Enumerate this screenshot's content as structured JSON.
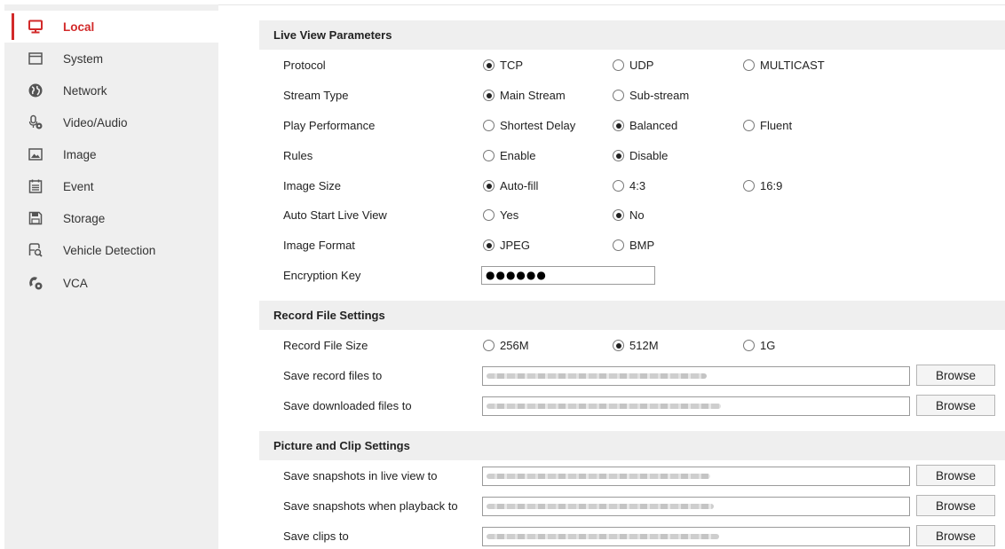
{
  "sidebar": {
    "items": [
      {
        "label": "Local",
        "icon": "monitor-icon",
        "active": true
      },
      {
        "label": "System",
        "icon": "window-icon"
      },
      {
        "label": "Network",
        "icon": "globe-icon"
      },
      {
        "label": "Video/Audio",
        "icon": "microphone-gear-icon"
      },
      {
        "label": "Image",
        "icon": "image-icon"
      },
      {
        "label": "Event",
        "icon": "calendar-icon"
      },
      {
        "label": "Storage",
        "icon": "floppy-icon"
      },
      {
        "label": "Vehicle Detection",
        "icon": "vehicle-search-icon"
      },
      {
        "label": "VCA",
        "icon": "vca-gear-icon"
      }
    ],
    "accent_color": "#d22a2a"
  },
  "live_view": {
    "title": "Live View Parameters",
    "protocol": {
      "label": "Protocol",
      "options": [
        "TCP",
        "UDP",
        "MULTICAST"
      ],
      "selected": "TCP"
    },
    "stream_type": {
      "label": "Stream Type",
      "options": [
        "Main Stream",
        "Sub-stream"
      ],
      "selected": "Main Stream"
    },
    "play_performance": {
      "label": "Play Performance",
      "options": [
        "Shortest Delay",
        "Balanced",
        "Fluent"
      ],
      "selected": "Balanced"
    },
    "rules": {
      "label": "Rules",
      "options": [
        "Enable",
        "Disable"
      ],
      "selected": "Disable"
    },
    "image_size": {
      "label": "Image Size",
      "options": [
        "Auto-fill",
        "4:3",
        "16:9"
      ],
      "selected": "Auto-fill"
    },
    "auto_start": {
      "label": "Auto Start Live View",
      "options": [
        "Yes",
        "No"
      ],
      "selected": "No"
    },
    "image_format": {
      "label": "Image Format",
      "options": [
        "JPEG",
        "BMP"
      ],
      "selected": "JPEG"
    },
    "encryption_key": {
      "label": "Encryption Key",
      "value": "●●●●●●"
    }
  },
  "record": {
    "title": "Record File Settings",
    "file_size": {
      "label": "Record File Size",
      "options": [
        "256M",
        "512M",
        "1G"
      ],
      "selected": "512M"
    },
    "save_record_label": "Save record files to",
    "save_downloaded_label": "Save downloaded files to"
  },
  "picture": {
    "title": "Picture and Clip Settings",
    "save_snapshots_live_label": "Save snapshots in live view to",
    "save_snapshots_playback_label": "Save snapshots when playback to",
    "save_clips_label": "Save clips to"
  },
  "browse_label": "Browse"
}
